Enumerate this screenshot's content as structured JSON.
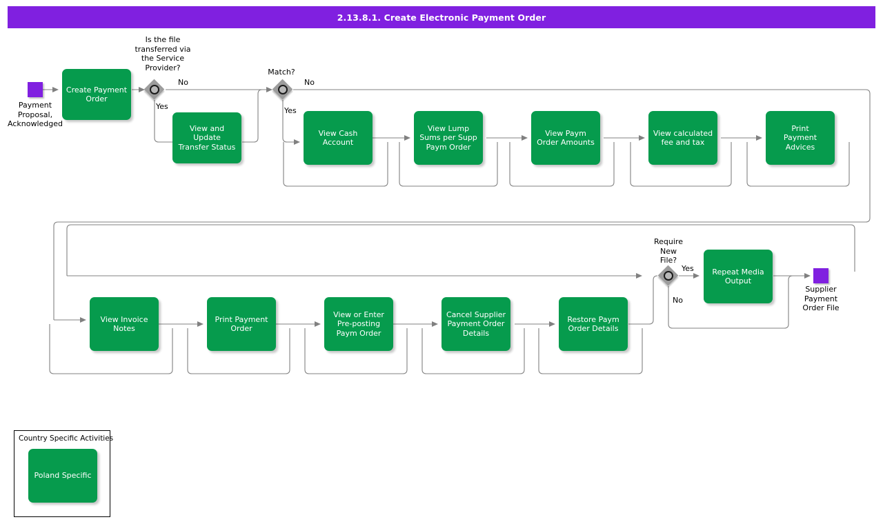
{
  "header": {
    "title": "2.13.8.1. Create Electronic Payment Order",
    "bar_color": "#8020e0",
    "title_color": "#ffffff"
  },
  "theme": {
    "task_fill": "#069b4d",
    "task_text": "#ffffff",
    "event_fill": "#8020e0",
    "gateway_fill": "#9c9c9c",
    "connector": "#808080",
    "page_background": "#ffffff"
  },
  "diagram": {
    "type": "flowchart",
    "notation": "BPMN-like process flow",
    "start_events": [
      {
        "id": "start",
        "label": "Payment\nProposal,\nAcknowledged",
        "shape": "square",
        "color": "#8020e0"
      }
    ],
    "end_events": [
      {
        "id": "end",
        "label": "Supplier\nPayment\nOrder File",
        "shape": "square",
        "color": "#8020e0"
      }
    ],
    "gateways": [
      {
        "id": "gw1",
        "label": "Is the file\ntransferred via\nthe Service\nProvider?",
        "outputs": [
          "No",
          "Yes"
        ]
      },
      {
        "id": "gw2",
        "label": "Match?",
        "outputs": [
          "No",
          "Yes"
        ]
      },
      {
        "id": "gw3",
        "label": "Require\nNew\nFile?",
        "outputs": [
          "Yes",
          "No"
        ]
      }
    ],
    "tasks": [
      {
        "id": "t01",
        "label": "Create Payment\nOrder"
      },
      {
        "id": "t02",
        "label": "View and Update\nTransfer Status"
      },
      {
        "id": "t03",
        "label": "View Cash\nAccount"
      },
      {
        "id": "t04",
        "label": "View Lump\nSums per Supp\nPaym Order"
      },
      {
        "id": "t05",
        "label": "View Paym\nOrder Amounts"
      },
      {
        "id": "t06",
        "label": "View calculated\nfee and tax"
      },
      {
        "id": "t07",
        "label": "Print\nPayment\nAdvices"
      },
      {
        "id": "t08",
        "label": "View Invoice\nNotes"
      },
      {
        "id": "t09",
        "label": "Print Payment\nOrder"
      },
      {
        "id": "t10",
        "label": "View or Enter\nPre-posting\nPaym Order"
      },
      {
        "id": "t11",
        "label": "Cancel Supplier\nPayment Order\nDetails"
      },
      {
        "id": "t12",
        "label": "Restore Paym\nOrder Details"
      },
      {
        "id": "t13",
        "label": "Repeat Media\nOutput"
      },
      {
        "id": "t14",
        "label": "Poland Specific"
      }
    ],
    "edge_labels": {
      "gw1_no": "No",
      "gw1_yes": "Yes",
      "gw2_no": "No",
      "gw2_yes": "Yes",
      "gw3_yes": "Yes",
      "gw3_no": "No"
    },
    "groups": [
      {
        "id": "country",
        "title": "Country Specific Activities",
        "members": [
          "t14"
        ]
      }
    ]
  }
}
